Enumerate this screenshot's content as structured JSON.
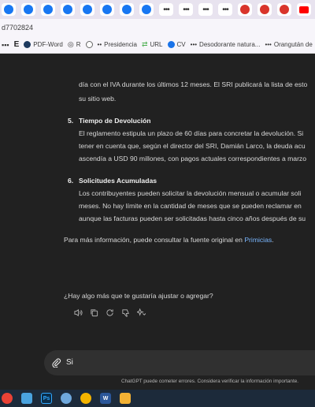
{
  "browser": {
    "tabs": [
      {
        "icon": "facebook-icon"
      },
      {
        "icon": "facebook-icon"
      },
      {
        "icon": "facebook-icon"
      },
      {
        "icon": "facebook-icon"
      },
      {
        "icon": "facebook-icon"
      },
      {
        "icon": "facebook-icon"
      },
      {
        "icon": "facebook-icon"
      },
      {
        "icon": "facebook-icon"
      },
      {
        "icon": "more-dots-icon"
      },
      {
        "icon": "more-dots-icon"
      },
      {
        "icon": "more-dots-icon"
      },
      {
        "icon": "more-dots-icon"
      },
      {
        "icon": "news-icon"
      },
      {
        "icon": "news-icon"
      },
      {
        "icon": "youtube-icon"
      }
    ],
    "url_fragment": "d7702824",
    "bookmarks": [
      {
        "label": "",
        "icon": "apps-icon"
      },
      {
        "label": "",
        "icon": "e-icon"
      },
      {
        "label": "PDF-Word",
        "icon": "pdf-icon"
      },
      {
        "label": "R",
        "icon": "r-icon"
      },
      {
        "label": "",
        "icon": "seal-icon"
      },
      {
        "label": "Presidencia",
        "icon": "dots-icon"
      },
      {
        "label": "URL",
        "icon": "link-icon"
      },
      {
        "label": "CV",
        "icon": "cv-icon"
      },
      {
        "label": "Desodorante natura...",
        "icon": "dots-icon"
      },
      {
        "label": "Orangután de",
        "icon": "dots-icon"
      }
    ]
  },
  "chat": {
    "para_top_line1": "día con el IVA durante los últimos 12 meses. El SRI publicará la lista de esto",
    "para_top_line2": "su sitio web.",
    "item5": {
      "number": "5.",
      "title": "Tiempo de Devolución",
      "lines": [
        "El reglamento estipula un plazo de 60 días para concretar la devolución. Si",
        "tener en cuenta que, según el director del SRI, Damián Larco, la deuda acu",
        "ascendía a USD 90 millones, con pagos actuales correspondientes a marzo"
      ]
    },
    "item6": {
      "number": "6.",
      "title": "Solicitudes Acumuladas",
      "lines": [
        "Los contribuyentes pueden solicitar la devolución mensual o acumular soli",
        "meses. No hay límite en la cantidad de meses que se pueden reclamar en",
        "aunque las facturas pueden ser solicitadas hasta cinco años después de su"
      ]
    },
    "source_prefix": "Para más información, puede consultar la fuente original en ",
    "source_link": "Primicias",
    "source_suffix": ".",
    "question": "¿Hay algo más que te gustaría ajustar o agregar?",
    "input_value": "Si",
    "disclaimer": "ChatGPT puede cometer errores. Considera verificar la información importante."
  },
  "taskbar": {
    "apps": [
      {
        "icon": "chrome-icon",
        "color": "#e94235"
      },
      {
        "icon": "files-icon",
        "color": "#4aa3df"
      },
      {
        "icon": "photoshop-icon",
        "color": "#0a2d4a",
        "label": "Ps"
      },
      {
        "icon": "bird-icon",
        "color": "#6fa8dc"
      },
      {
        "icon": "chrome-alt-icon",
        "color": "#f4b400"
      },
      {
        "icon": "word-icon",
        "color": "#2b579a",
        "label": "W"
      },
      {
        "icon": "video-icon",
        "color": "#f2b134"
      }
    ]
  }
}
